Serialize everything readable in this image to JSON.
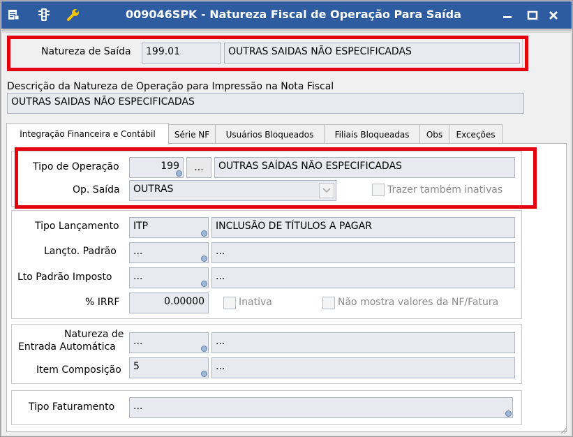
{
  "window": {
    "title": "009046SPK - Natureza Fiscal de Operação Para Saída",
    "icons": [
      "menu-icon",
      "traffic-light-icon",
      "wrench-icon"
    ],
    "controls": [
      "minimize-icon",
      "maximize-icon",
      "close-icon"
    ]
  },
  "header": {
    "natureza_label": "Natureza de Saída",
    "natureza_code": "199.01",
    "natureza_desc": "OUTRAS SAIDAS NÃO ESPECIFICADAS",
    "descricao_label": "Descrição da Natureza de Operação para Impressão na Nota Fiscal",
    "descricao_value": "OUTRAS SAIDAS NÃO ESPECIFICADAS"
  },
  "tabs": [
    {
      "label": "Integração Financeira e Contábil",
      "active": true
    },
    {
      "label": "Série NF",
      "active": false
    },
    {
      "label": "Usuários Bloqueados",
      "active": false
    },
    {
      "label": "Filiais Bloqueadas",
      "active": false
    },
    {
      "label": "Obs",
      "active": false
    },
    {
      "label": "Exceções",
      "active": false
    }
  ],
  "operacao": {
    "tipo_label": "Tipo de Operação",
    "tipo_code": "199",
    "ellipsis": "...",
    "tipo_desc": "OUTRAS SAÍDAS NÃO ESPECIFICADAS",
    "op_saida_label": "Op. Saída",
    "op_saida_value": "OUTRAS",
    "trazer_label": "Trazer também inativas"
  },
  "lancamento": {
    "tipo_label": "Tipo Lançamento",
    "tipo_code": "ITP",
    "tipo_desc": "INCLUSÃO DE TÍTULOS A PAGAR",
    "padrao_label": "Lançto. Padrão",
    "padrao_code": "...",
    "padrao_desc": "...",
    "imposto_label": "Lto Padrão Imposto",
    "imposto_code": "...",
    "imposto_desc": "...",
    "irrf_label": "% IRRF",
    "irrf_value": "0.00000",
    "inativa_label": "Inativa",
    "nao_mostra_label": "Não mostra valores da NF/Fatura"
  },
  "entrada": {
    "natureza_label_1": "Natureza de",
    "natureza_label_2": "Entrada Automática",
    "natureza_code": "...",
    "natureza_desc": "...",
    "item_label": "Item Composição",
    "item_code": "5",
    "item_desc": "..."
  },
  "faturamento": {
    "tipo_label": "Tipo Faturamento",
    "tipo_value": "..."
  },
  "colors": {
    "titlebar": "#2d5da0",
    "highlight": "#e3000f"
  }
}
